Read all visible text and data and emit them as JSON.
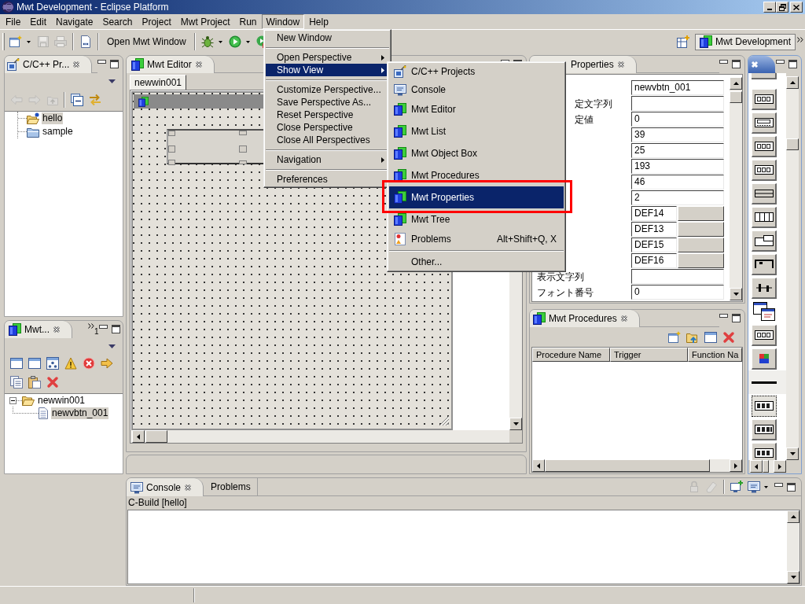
{
  "window": {
    "title": "Mwt Development - Eclipse Platform"
  },
  "menu_bar": [
    {
      "label": "File",
      "selected": false
    },
    {
      "label": "Edit",
      "selected": false
    },
    {
      "label": "Navigate",
      "selected": false
    },
    {
      "label": "Search",
      "selected": false
    },
    {
      "label": "Project",
      "selected": false
    },
    {
      "label": "Mwt Project",
      "selected": false
    },
    {
      "label": "Run",
      "selected": false
    },
    {
      "label": "Window",
      "selected": true
    },
    {
      "label": "Help",
      "selected": false
    }
  ],
  "toolbar": {
    "items": [
      {
        "kind": "new",
        "dropdown": true,
        "disabled": false
      },
      {
        "kind": "save",
        "dropdown": false,
        "disabled": true
      },
      {
        "kind": "print",
        "dropdown": false,
        "disabled": true
      },
      {
        "kind": "separator"
      },
      {
        "kind": "binary",
        "dropdown": false,
        "disabled": false
      },
      {
        "kind": "separator"
      },
      {
        "kind": "text",
        "label": "Open Mwt Window"
      },
      {
        "kind": "separator"
      },
      {
        "kind": "debug",
        "dropdown": true,
        "disabled": false
      },
      {
        "kind": "run",
        "dropdown": true,
        "disabled": false
      },
      {
        "kind": "external",
        "dropdown": false,
        "disabled": false
      }
    ],
    "perspective": {
      "label": "Mwt Development",
      "selected": true
    }
  },
  "project_explorer": {
    "tab": "C/C++ Pr...",
    "toolbar": [
      {
        "kind": "back",
        "disabled": true
      },
      {
        "kind": "forward",
        "disabled": true
      },
      {
        "kind": "up",
        "disabled": true
      },
      {
        "kind": "separator"
      },
      {
        "kind": "collapse_all",
        "disabled": false
      },
      {
        "kind": "link",
        "disabled": false
      }
    ],
    "tree": [
      {
        "label": "hello",
        "kind": "c_project",
        "selected": true
      },
      {
        "label": "sample",
        "kind": "source_folder",
        "selected": false
      }
    ]
  },
  "mwt_tree": {
    "tab": "Mwt...",
    "hidden_views": "1",
    "toolbar": [
      {
        "kind": "window"
      },
      {
        "kind": "window"
      },
      {
        "kind": "window_grid"
      },
      {
        "kind": "warning"
      },
      {
        "kind": "error"
      },
      {
        "kind": "arrow"
      },
      {
        "kind": "copy"
      },
      {
        "kind": "paste"
      },
      {
        "kind": "delete"
      }
    ],
    "tree": [
      {
        "label": "newwin001",
        "kind": "folder",
        "expanded": true,
        "selected": false,
        "children": [
          {
            "label": "newvbtn_001",
            "kind": "document",
            "selected": true
          }
        ]
      }
    ]
  },
  "editor": {
    "tab": "Mwt Editor",
    "page_tabs": [
      {
        "label": "newwin001",
        "selected": true
      }
    ]
  },
  "properties": {
    "tab": "Properties",
    "rows": [
      {
        "kind": "text",
        "value": "newvbtn_001"
      },
      {
        "kind": "text",
        "label": "定文字列",
        "covered": true
      },
      {
        "kind": "text",
        "label": "定値",
        "covered": true,
        "value": "0"
      },
      {
        "kind": "text",
        "value": "39"
      },
      {
        "kind": "text",
        "value": "25"
      },
      {
        "kind": "text",
        "value": "193"
      },
      {
        "kind": "text",
        "value": "46"
      },
      {
        "kind": "text",
        "value": "2"
      },
      {
        "kind": "button",
        "value": "DEF14"
      },
      {
        "kind": "button",
        "value": "DEF13"
      },
      {
        "kind": "button",
        "value": "DEF15"
      },
      {
        "kind": "button",
        "value": "DEF16"
      },
      {
        "kind": "text",
        "label": "表示文字列",
        "covered": false
      },
      {
        "kind": "text",
        "label": "フォント番号",
        "covered": false,
        "value": "0"
      }
    ]
  },
  "procedures": {
    "tab": "Mwt Procedures",
    "toolbar": [
      {
        "kind": "new"
      },
      {
        "kind": "import"
      },
      {
        "kind": "window"
      },
      {
        "kind": "delete"
      }
    ],
    "columns": [
      "Procedure Name",
      "Trigger",
      "Function Na"
    ]
  },
  "palette": {
    "items": [
      {
        "kind": "partial",
        "selected": false
      },
      {
        "kind": "form",
        "selected": false
      },
      {
        "kind": "scroll",
        "selected": false
      },
      {
        "kind": "header",
        "selected": false
      },
      {
        "kind": "exec",
        "selected": false
      },
      {
        "kind": "hline",
        "selected": false
      },
      {
        "kind": "columns",
        "selected": false
      },
      {
        "kind": "split",
        "selected": false
      },
      {
        "kind": "bracket",
        "selected": false
      },
      {
        "kind": "slider",
        "selected": false
      },
      {
        "kind": "windows",
        "selected": false
      },
      {
        "kind": "label",
        "selected": false
      },
      {
        "kind": "color",
        "selected": false
      },
      {
        "kind": "separator",
        "selected": false
      },
      {
        "kind": "button",
        "selected": true
      },
      {
        "kind": "fbutton",
        "selected": false
      },
      {
        "kind": "toggle",
        "selected": false
      }
    ]
  },
  "console": {
    "tabs": [
      {
        "label": "Console",
        "kind": "console",
        "selected": true
      },
      {
        "label": "Problems",
        "kind": "problems",
        "selected": false
      }
    ],
    "toolbar": [
      {
        "kind": "lock",
        "disabled": true
      },
      {
        "kind": "clear",
        "disabled": true
      },
      {
        "kind": "separator"
      },
      {
        "kind": "pin",
        "disabled": false
      },
      {
        "kind": "display",
        "disabled": false,
        "dropdown": true
      }
    ],
    "title": "C-Build [hello]"
  },
  "window_menu": {
    "items": [
      {
        "kind": "item",
        "label": "New Window",
        "selected": false
      },
      {
        "kind": "separator"
      },
      {
        "kind": "submenu",
        "label": "Open Perspective",
        "selected": false
      },
      {
        "kind": "submenu",
        "label": "Show View",
        "selected": true
      },
      {
        "kind": "separator"
      },
      {
        "kind": "item",
        "label": "Customize Perspective...",
        "selected": false
      },
      {
        "kind": "item",
        "label": "Save Perspective As...",
        "selected": false
      },
      {
        "kind": "item",
        "label": "Reset Perspective",
        "selected": false
      },
      {
        "kind": "item",
        "label": "Close Perspective",
        "selected": false
      },
      {
        "kind": "item",
        "label": "Close All Perspectives",
        "selected": false
      },
      {
        "kind": "separator"
      },
      {
        "kind": "submenu",
        "label": "Navigation",
        "selected": false
      },
      {
        "kind": "separator"
      },
      {
        "kind": "item",
        "label": "Preferences",
        "selected": false
      }
    ]
  },
  "show_view_menu": {
    "items": [
      {
        "kind": "cproject",
        "label": "C/C++ Projects",
        "selected": false,
        "highlighted": false
      },
      {
        "kind": "console",
        "label": "Console",
        "selected": false,
        "highlighted": false
      },
      {
        "kind": "mwt",
        "label": "Mwt Editor",
        "selected": false,
        "highlighted": false
      },
      {
        "kind": "mwt",
        "label": "Mwt List",
        "selected": false,
        "highlighted": false
      },
      {
        "kind": "mwt",
        "label": "Mwt Object Box",
        "selected": false,
        "highlighted": false
      },
      {
        "kind": "mwt",
        "label": "Mwt Procedures",
        "selected": false,
        "highlighted": false
      },
      {
        "kind": "mwt",
        "label": "Mwt Properties",
        "selected": true,
        "highlighted": true
      },
      {
        "kind": "mwt",
        "label": "Mwt Tree",
        "selected": false,
        "highlighted": false
      },
      {
        "kind": "problems",
        "label": "Problems",
        "shortcut": "Alt+Shift+Q, X",
        "selected": false,
        "highlighted": false
      },
      {
        "kind": "separator"
      },
      {
        "kind": "other",
        "label": "Other...",
        "selected": false,
        "highlighted": false
      }
    ]
  }
}
